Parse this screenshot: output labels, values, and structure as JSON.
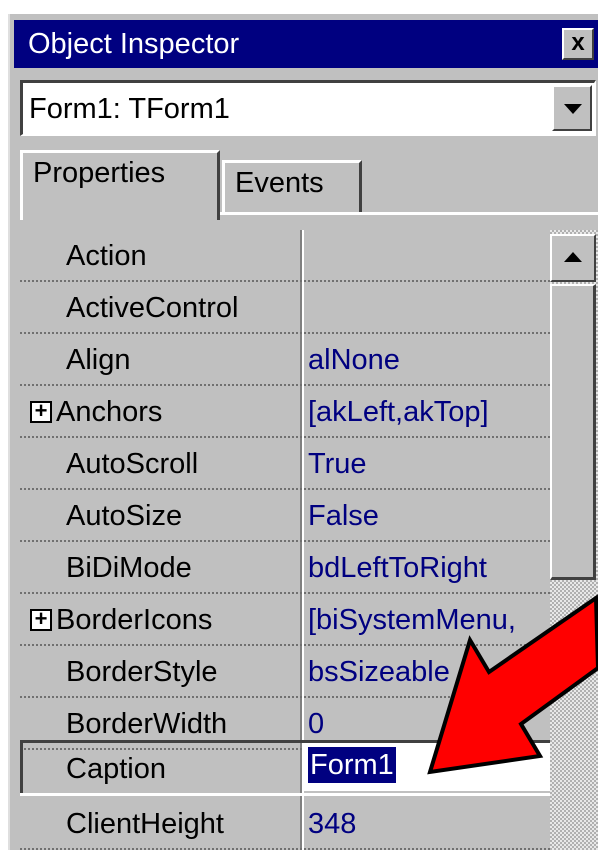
{
  "window": {
    "title": "Object Inspector",
    "close_glyph": "x"
  },
  "object_selector": {
    "value": "Form1: TForm1"
  },
  "tabs": [
    {
      "label": "Properties",
      "active": true
    },
    {
      "label": "Events",
      "active": false
    }
  ],
  "properties": [
    {
      "name": "Action",
      "value": "",
      "expandable": false
    },
    {
      "name": "ActiveControl",
      "value": "",
      "expandable": false
    },
    {
      "name": "Align",
      "value": "alNone",
      "expandable": false
    },
    {
      "name": "Anchors",
      "value": "[akLeft,akTop]",
      "expandable": true
    },
    {
      "name": "AutoScroll",
      "value": "True",
      "expandable": false
    },
    {
      "name": "AutoSize",
      "value": "False",
      "expandable": false
    },
    {
      "name": "BiDiMode",
      "value": "bdLeftToRight",
      "expandable": false
    },
    {
      "name": "BorderIcons",
      "value": "[biSystemMenu,",
      "expandable": true
    },
    {
      "name": "BorderStyle",
      "value": "bsSizeable",
      "expandable": false
    },
    {
      "name": "BorderWidth",
      "value": "0",
      "expandable": false
    },
    {
      "name": "Caption",
      "value": "Form1",
      "expandable": false,
      "selected": true
    },
    {
      "name": "ClientHeight",
      "value": "348",
      "expandable": false
    }
  ],
  "expander_glyph": "+",
  "colors": {
    "titlebar": "#000080",
    "value_text": "#000080",
    "face": "#c0c0c0",
    "arrow": "#ff0000"
  },
  "annotation": {
    "type": "arrow",
    "color": "#ff0000",
    "points_to": "Caption value"
  }
}
